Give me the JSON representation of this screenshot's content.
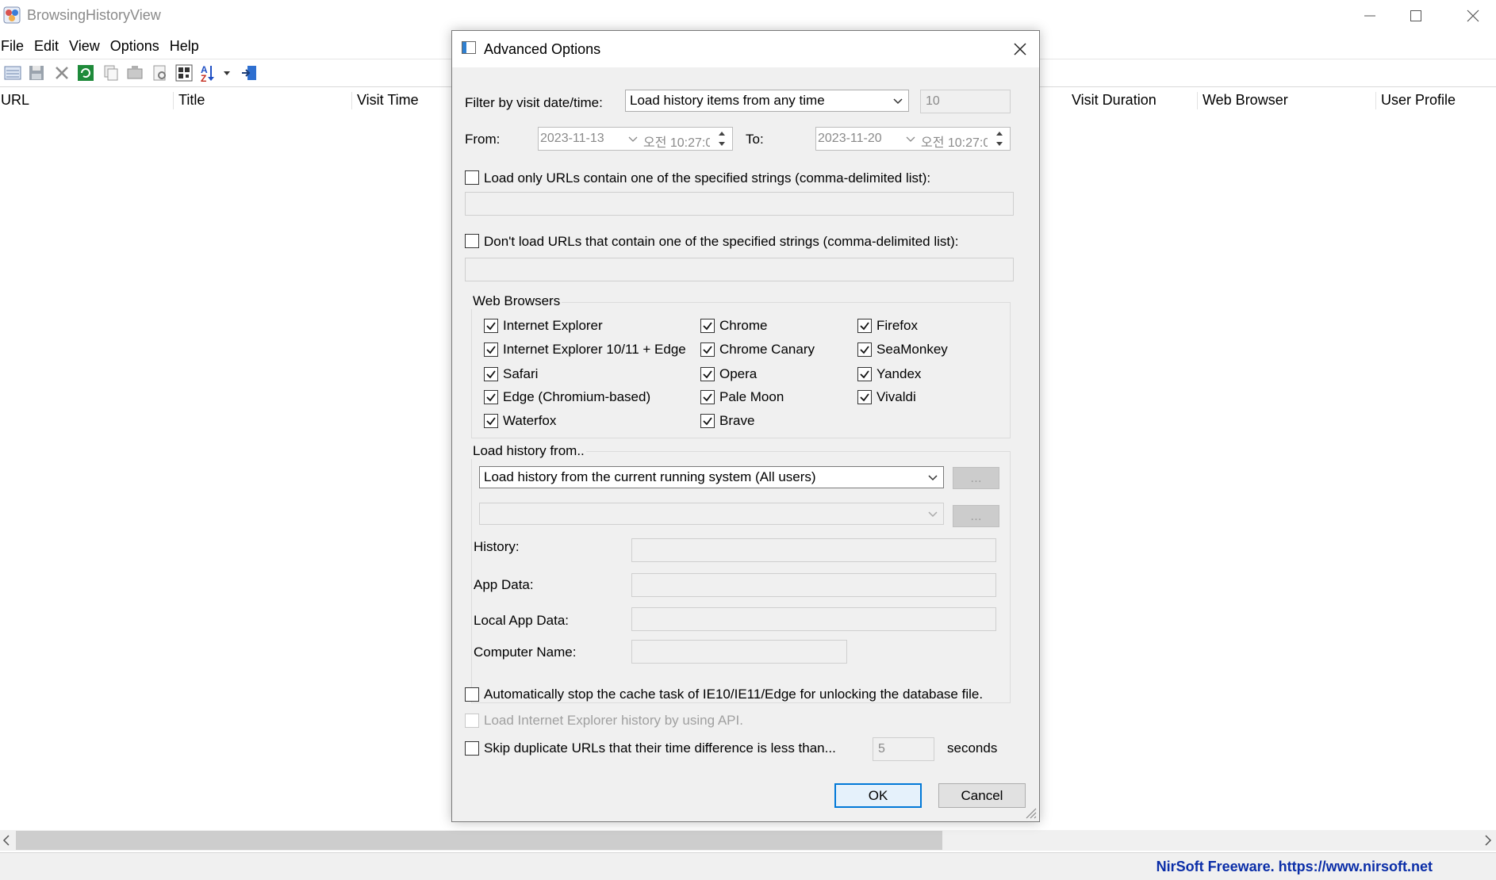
{
  "app": {
    "title": "BrowsingHistoryView",
    "menu": [
      "File",
      "Edit",
      "View",
      "Options",
      "Help"
    ],
    "columns": [
      "URL",
      "Title",
      "Visit Time",
      "Visit Duration",
      "Web Browser",
      "User Profile"
    ],
    "status_link": "NirSoft Freeware. https://www.nirsoft.net"
  },
  "dialog": {
    "title": "Advanced Options",
    "filter": {
      "label": "Filter by visit date/time:",
      "selected": "Load history items from any time",
      "value": "10"
    },
    "range": {
      "from_label": "From:",
      "from_date": "2023-11-13",
      "from_time": "오전 10:27:0",
      "to_label": "To:",
      "to_date": "2023-11-20",
      "to_time": "오전 10:27:0"
    },
    "include_urls": {
      "label": "Load only URLs contain one of the specified strings (comma-delimited list):",
      "checked": false,
      "value": ""
    },
    "exclude_urls": {
      "label": "Don't load URLs that contain one of the specified strings (comma-delimited list):",
      "checked": false,
      "value": ""
    },
    "web_browsers": {
      "title": "Web Browsers",
      "items": [
        {
          "label": "Internet Explorer",
          "checked": true
        },
        {
          "label": "Chrome",
          "checked": true
        },
        {
          "label": "Firefox",
          "checked": true
        },
        {
          "label": "Internet Explorer 10/11 + Edge",
          "checked": true
        },
        {
          "label": "Chrome Canary",
          "checked": true
        },
        {
          "label": "SeaMonkey",
          "checked": true
        },
        {
          "label": "Safari",
          "checked": true
        },
        {
          "label": "Opera",
          "checked": true
        },
        {
          "label": "Yandex",
          "checked": true
        },
        {
          "label": "Edge (Chromium-based)",
          "checked": true
        },
        {
          "label": "Pale Moon",
          "checked": true
        },
        {
          "label": "Vivaldi",
          "checked": true
        },
        {
          "label": "Waterfox",
          "checked": true
        },
        {
          "label": "Brave",
          "checked": true
        }
      ]
    },
    "load_from": {
      "title": "Load history from..",
      "selected": "Load history from the current running system (All users)",
      "browse_label": "...",
      "history_label": "History:",
      "appdata_label": "App Data:",
      "localappdata_label": "Local App Data:",
      "computer_label": "Computer Name:"
    },
    "auto_stop": {
      "label": "Automatically stop the cache task of IE10/IE11/Edge for unlocking the database file.",
      "checked": false
    },
    "ie_api": {
      "label": "Load Internet Explorer history by using API.",
      "checked": false
    },
    "skip_dup": {
      "label": "Skip duplicate URLs that their time difference is less than...",
      "checked": false,
      "value": "5",
      "unit": "seconds"
    },
    "ok_label": "OK",
    "cancel_label": "Cancel"
  },
  "colors": {
    "link": "#0b2ea8",
    "focus": "#0078d7"
  }
}
